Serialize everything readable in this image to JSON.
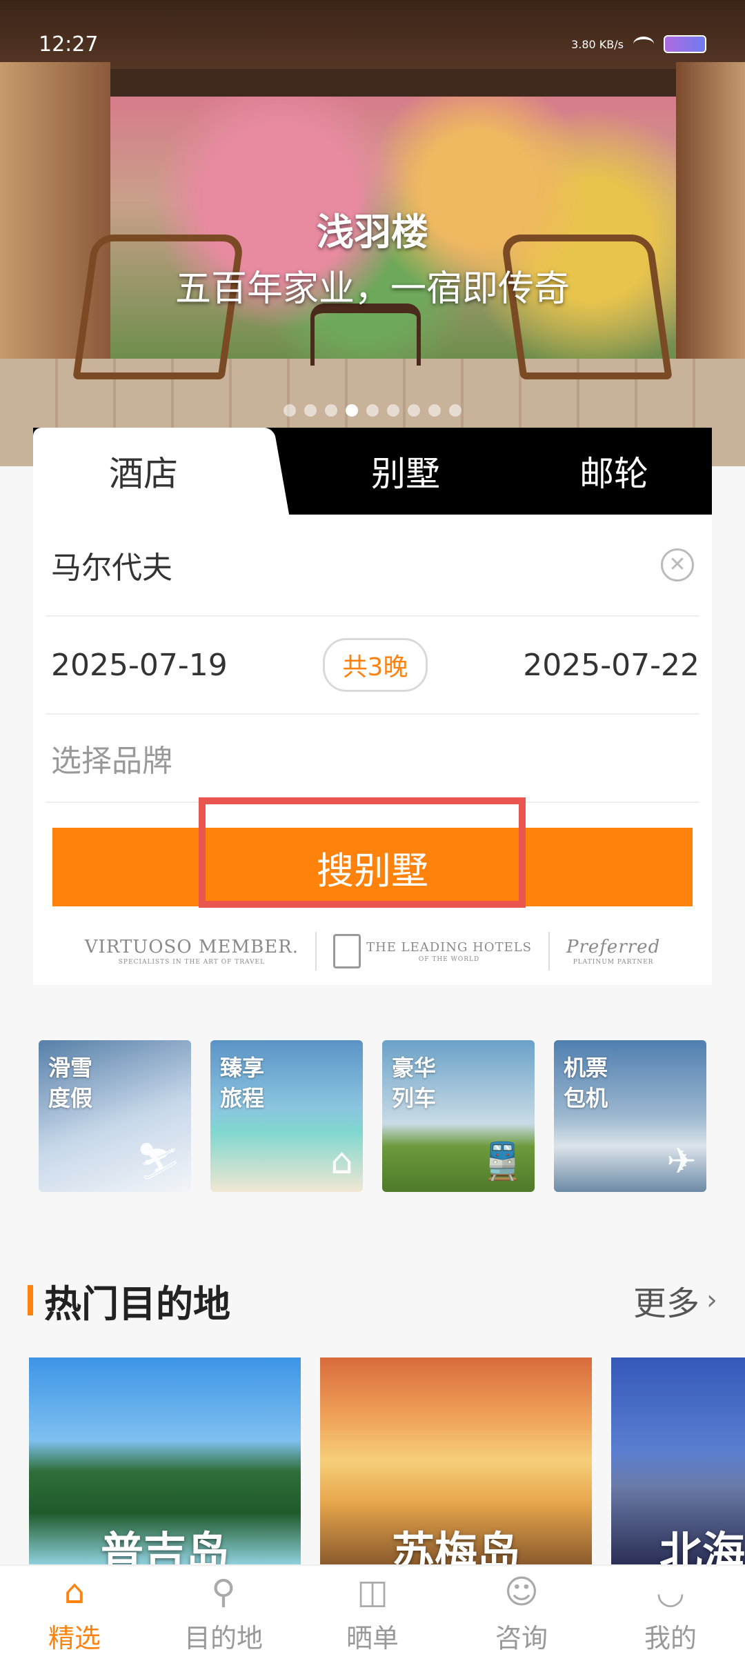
{
  "status_bar": {
    "time": "12:27",
    "speed": "3.80 KB/s"
  },
  "hero": {
    "title": "浅羽楼",
    "subtitle": "五百年家业，一宿即传奇",
    "slide_count": 9,
    "active_slide": 4
  },
  "tabs": [
    {
      "label": "酒店",
      "active": true
    },
    {
      "label": "别墅",
      "active": false
    },
    {
      "label": "邮轮",
      "active": false
    }
  ],
  "search": {
    "destination": "马尔代夫",
    "clear_icon": "clear-circle-icon",
    "checkin": "2025-07-19",
    "nights": "共3晚",
    "checkout": "2025-07-22",
    "brand_placeholder": "选择品牌",
    "button_label": "搜别墅"
  },
  "partners": [
    {
      "name": "VIRTUOSO MEMBER.",
      "tagline": "SPECIALISTS IN THE ART OF TRAVEL"
    },
    {
      "name": "THE LEADING HOTELS",
      "tagline": "OF THE WORLD"
    },
    {
      "name": "Preferred",
      "tagline": "PLATINUM PARTNER"
    }
  ],
  "quick_tiles": [
    {
      "line1": "滑雪",
      "line2": "度假",
      "icon": "skier-icon"
    },
    {
      "line1": "臻享",
      "line2": "旅程",
      "icon": "beach-house-icon"
    },
    {
      "line1": "豪华",
      "line2": "列车",
      "icon": "train-icon"
    },
    {
      "line1": "机票",
      "line2": "包机",
      "icon": "plane-icon"
    }
  ],
  "hot_destinations": {
    "title": "热门目的地",
    "more": "更多",
    "items": [
      "普吉岛",
      "苏梅岛",
      "北海"
    ]
  },
  "bottom_nav": [
    {
      "label": "精选",
      "icon": "home-icon",
      "active": true
    },
    {
      "label": "目的地",
      "icon": "location-pin-icon",
      "active": false
    },
    {
      "label": "晒单",
      "icon": "camera-icon",
      "active": false
    },
    {
      "label": "咨询",
      "icon": "chat-bubble-icon",
      "active": false
    },
    {
      "label": "我的",
      "icon": "user-smile-icon",
      "active": false
    }
  ],
  "colors": {
    "accent": "#ff820c",
    "highlight_box": "#e8564f"
  }
}
